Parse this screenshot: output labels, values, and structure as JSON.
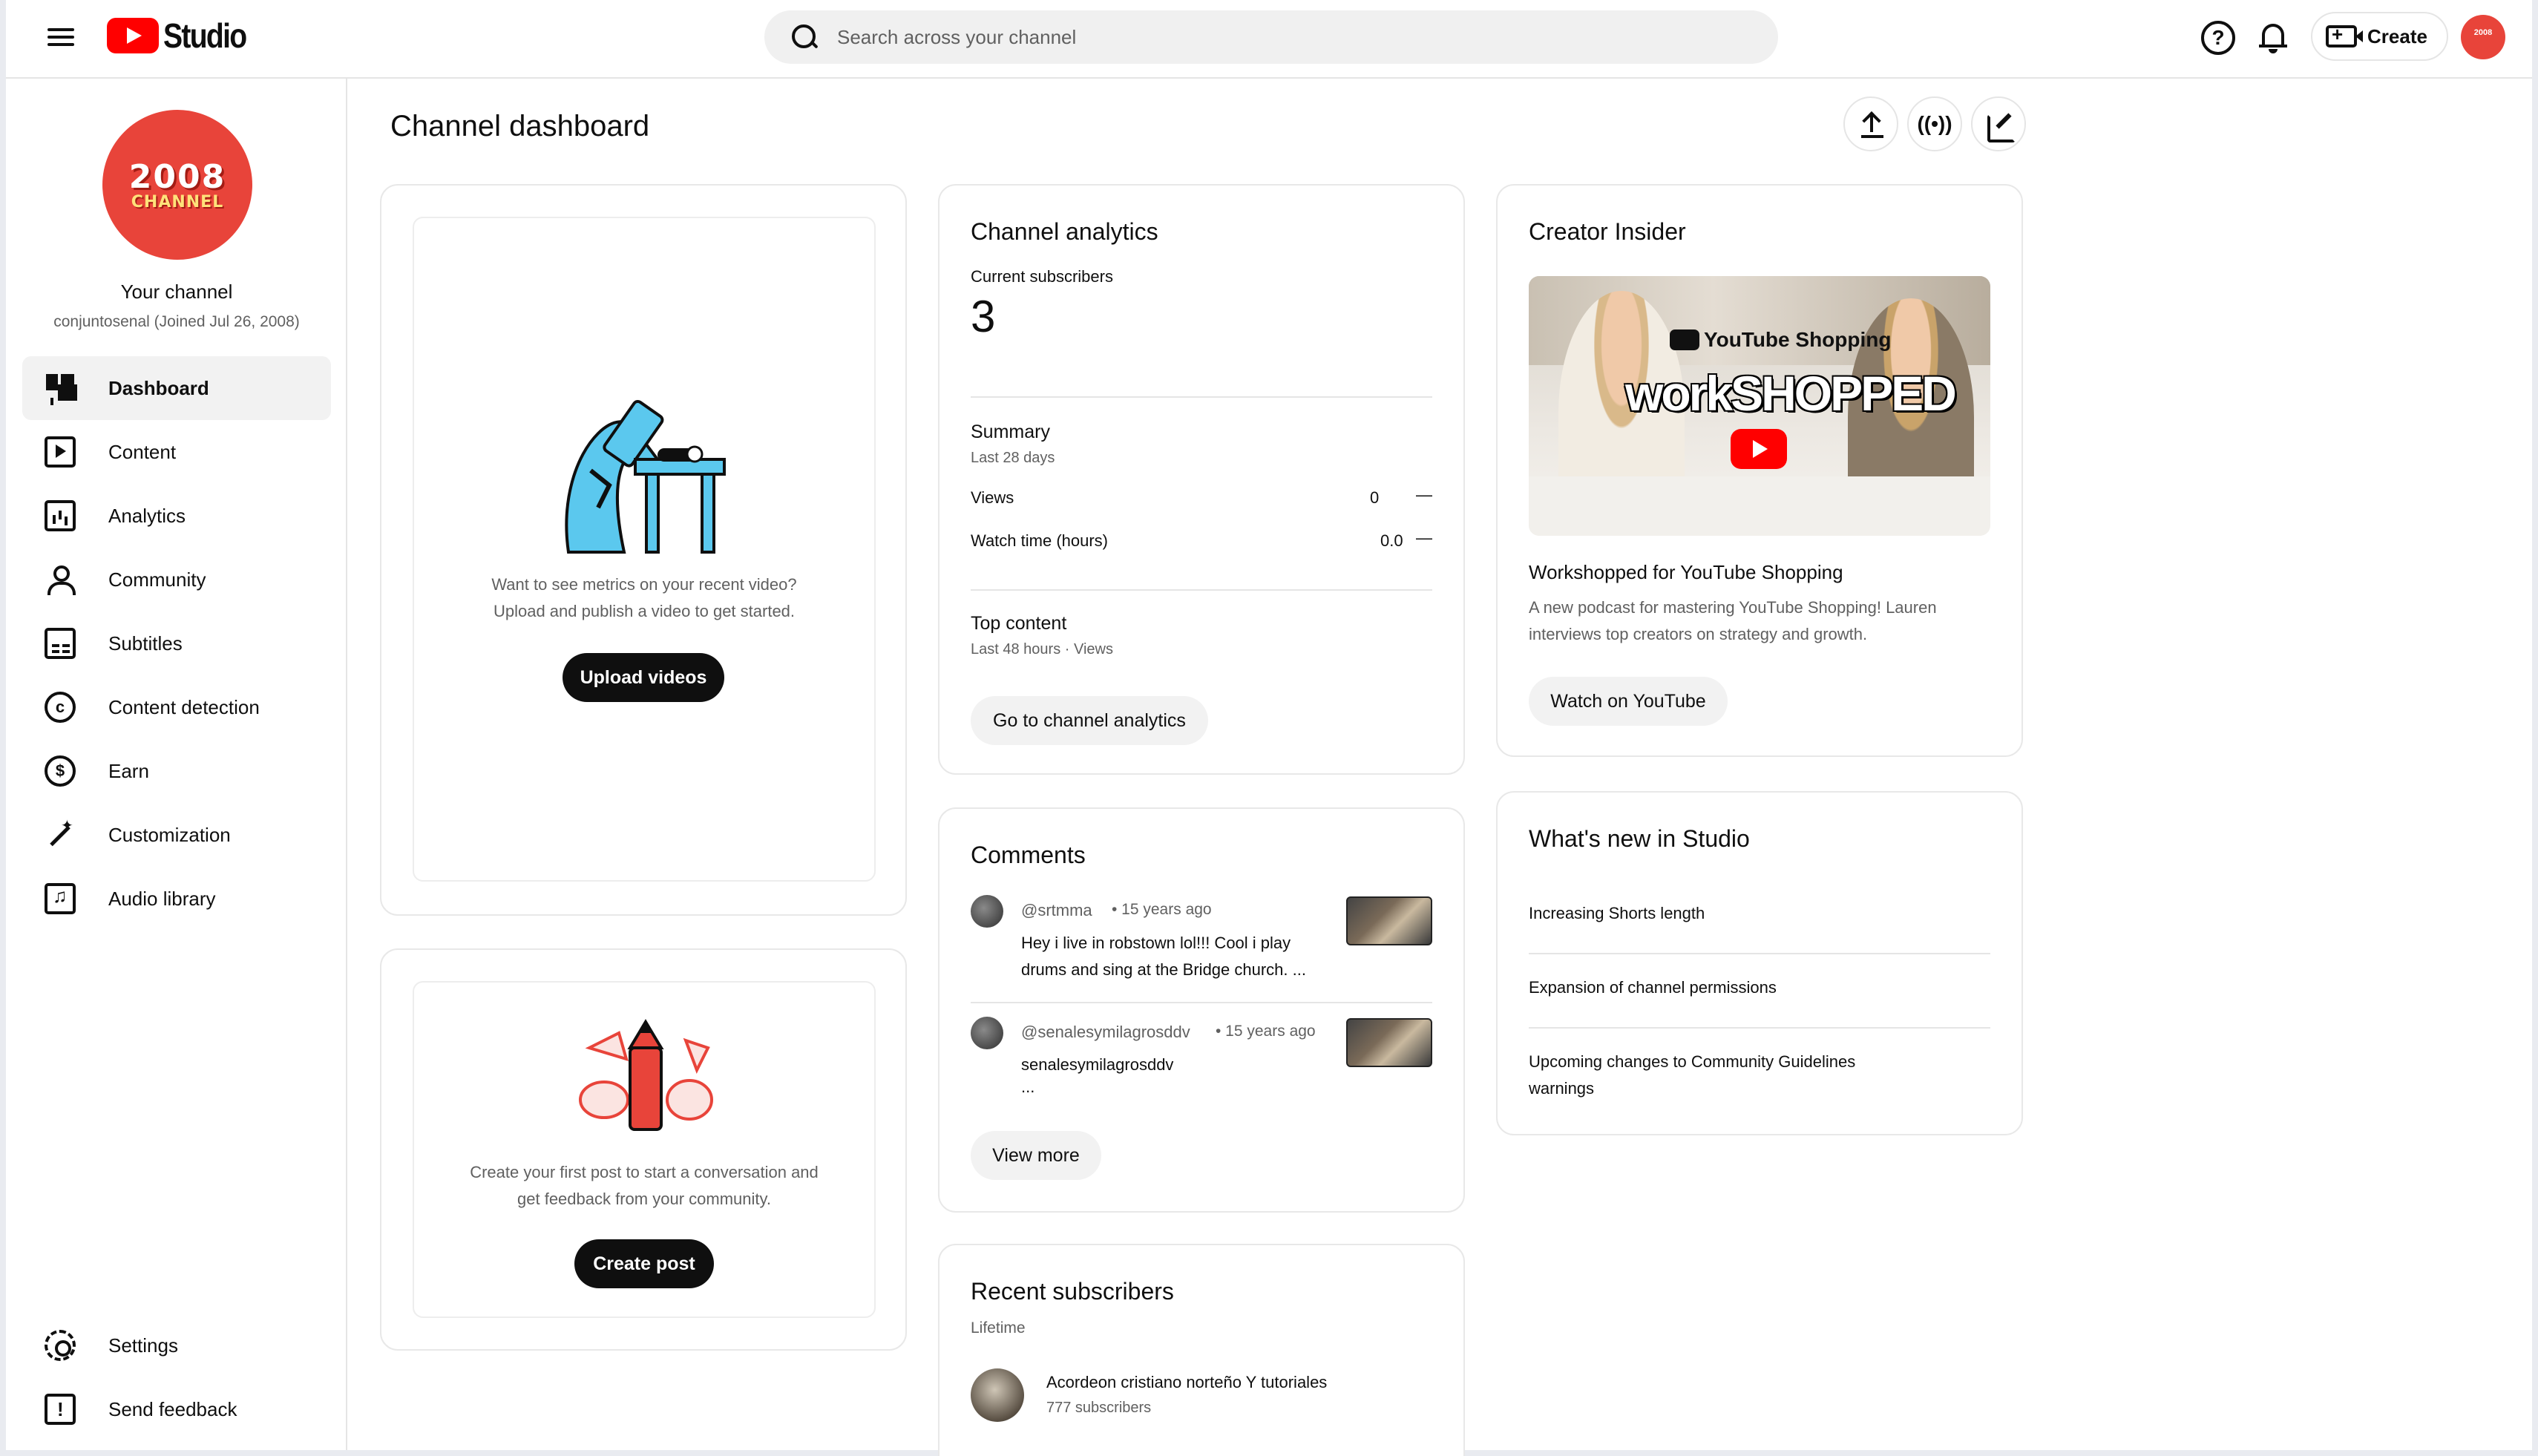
{
  "header": {
    "app_name": "Studio",
    "search_placeholder": "Search across your channel",
    "create_label": "Create",
    "avatar_text": "2008"
  },
  "sidebar": {
    "channel_avatar": {
      "line1": "2008",
      "line2": "CHANNEL"
    },
    "channel_label": "Your channel",
    "handle": "conjuntosenal (Joined Jul 26, 2008)",
    "items": [
      {
        "label": "Dashboard",
        "icon": "dashboard-icon",
        "active": true
      },
      {
        "label": "Content",
        "icon": "content-icon"
      },
      {
        "label": "Analytics",
        "icon": "analytics-icon"
      },
      {
        "label": "Community",
        "icon": "community-icon"
      },
      {
        "label": "Subtitles",
        "icon": "subtitles-icon"
      },
      {
        "label": "Content detection",
        "icon": "copyright-icon"
      },
      {
        "label": "Earn",
        "icon": "dollar-icon"
      },
      {
        "label": "Customization",
        "icon": "magic-wand-icon"
      },
      {
        "label": "Audio library",
        "icon": "audio-library-icon"
      }
    ],
    "bottom_items": [
      {
        "label": "Settings",
        "icon": "gear-icon"
      },
      {
        "label": "Send feedback",
        "icon": "feedback-icon"
      }
    ]
  },
  "main": {
    "title": "Channel dashboard",
    "upload_card": {
      "text1": "Want to see metrics on your recent video?",
      "text2": "Upload and publish a video to get started.",
      "button": "Upload videos"
    },
    "post_card": {
      "text1": "Create your first post to start a conversation and",
      "text2": "get feedback from your community.",
      "button": "Create post"
    },
    "analytics": {
      "title": "Channel analytics",
      "subs_label": "Current subscribers",
      "subs_value": "3",
      "summary_title": "Summary",
      "summary_period": "Last 28 days",
      "rows": [
        {
          "label": "Views",
          "value": "0",
          "trend": "—"
        },
        {
          "label": "Watch time (hours)",
          "value": "0.0",
          "trend": "—"
        }
      ],
      "top_content_title": "Top content",
      "top_content_period": "Last 48 hours · Views",
      "button": "Go to channel analytics"
    },
    "comments": {
      "title": "Comments",
      "items": [
        {
          "author": "@srtmma",
          "time": "• 15 years ago",
          "line1": "Hey i live in robstown lol!!! Cool i play",
          "line2": "drums and sing at the Bridge church. ..."
        },
        {
          "author": "@senalesymilagrosddv",
          "time": "• 15 years ago",
          "line1": "senalesymilagrosddv",
          "line2": "..."
        }
      ],
      "button": "View more"
    },
    "recent_subs": {
      "title": "Recent subscribers",
      "period": "Lifetime",
      "items": [
        {
          "name": "Acordeon cristiano norteño Y tutoriales",
          "subs": "777 subscribers"
        }
      ]
    },
    "creator_insider": {
      "title": "Creator Insider",
      "thumb_brand": "YouTube Shopping",
      "thumb_text": "workSHOPPED",
      "video_title": "Workshopped for YouTube Shopping",
      "desc1": "A new podcast for mastering YouTube Shopping! Lauren",
      "desc2": "interviews top creators on strategy and growth.",
      "button": "Watch on YouTube"
    },
    "whats_new": {
      "title": "What's new in Studio",
      "items": [
        "Increasing Shorts length",
        "Expansion of channel permissions",
        "Upcoming changes to Community Guidelines",
        "warnings"
      ]
    }
  }
}
